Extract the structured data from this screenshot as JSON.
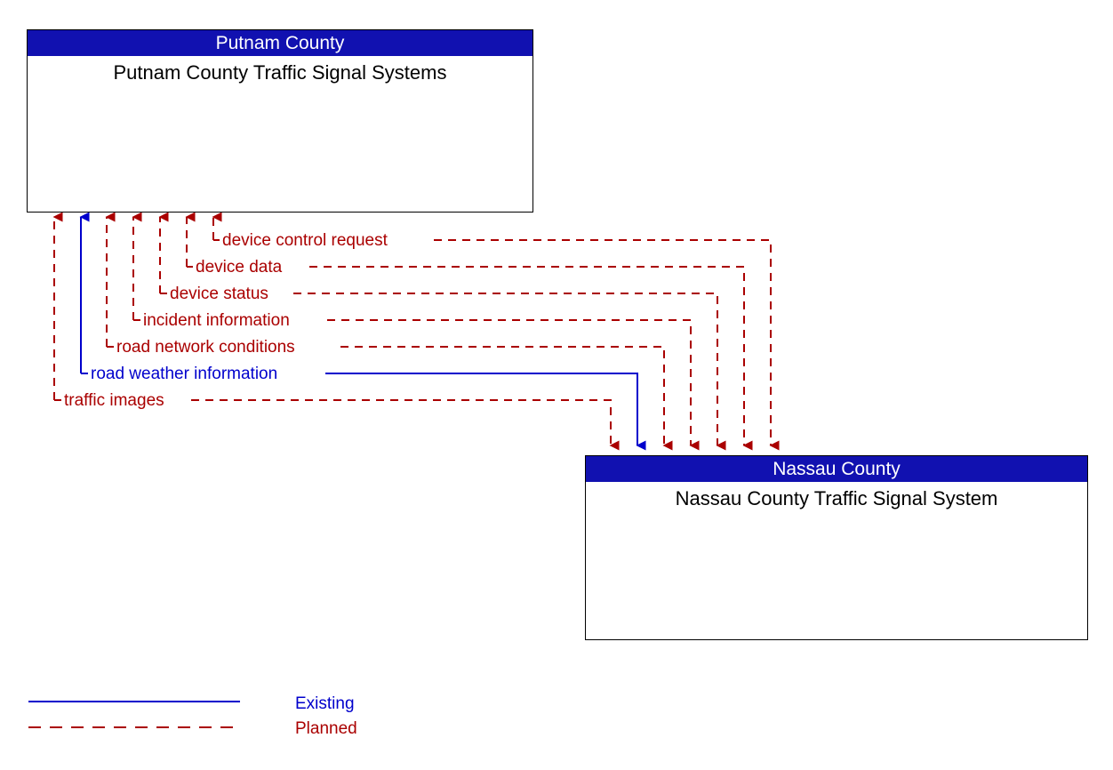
{
  "diagram": {
    "nodes": [
      {
        "id": "putnam",
        "header": "Putnam County",
        "title": "Putnam County Traffic Signal Systems"
      },
      {
        "id": "nassau",
        "header": "Nassau County",
        "title": "Nassau County Traffic Signal System"
      }
    ],
    "flows": [
      {
        "label": "device control request",
        "status": "Planned",
        "color": "#aa0000",
        "direction": "bidirectional"
      },
      {
        "label": "device data",
        "status": "Planned",
        "color": "#aa0000",
        "direction": "bidirectional"
      },
      {
        "label": "device status",
        "status": "Planned",
        "color": "#aa0000",
        "direction": "bidirectional"
      },
      {
        "label": "incident information",
        "status": "Planned",
        "color": "#aa0000",
        "direction": "bidirectional"
      },
      {
        "label": "road network conditions",
        "status": "Planned",
        "color": "#aa0000",
        "direction": "bidirectional"
      },
      {
        "label": "road weather information",
        "status": "Existing",
        "color": "#0000cc",
        "direction": "bidirectional"
      },
      {
        "label": "traffic images",
        "status": "Planned",
        "color": "#aa0000",
        "direction": "bidirectional"
      }
    ],
    "legend": [
      {
        "label": "Existing",
        "color": "#0000cc",
        "style": "solid"
      },
      {
        "label": "Planned",
        "color": "#aa0000",
        "style": "dashed"
      }
    ],
    "colors": {
      "header_blue": "#1111b0",
      "planned_red": "#aa0000",
      "existing_blue": "#0000cc",
      "border": "#000000",
      "background": "#ffffff"
    }
  }
}
